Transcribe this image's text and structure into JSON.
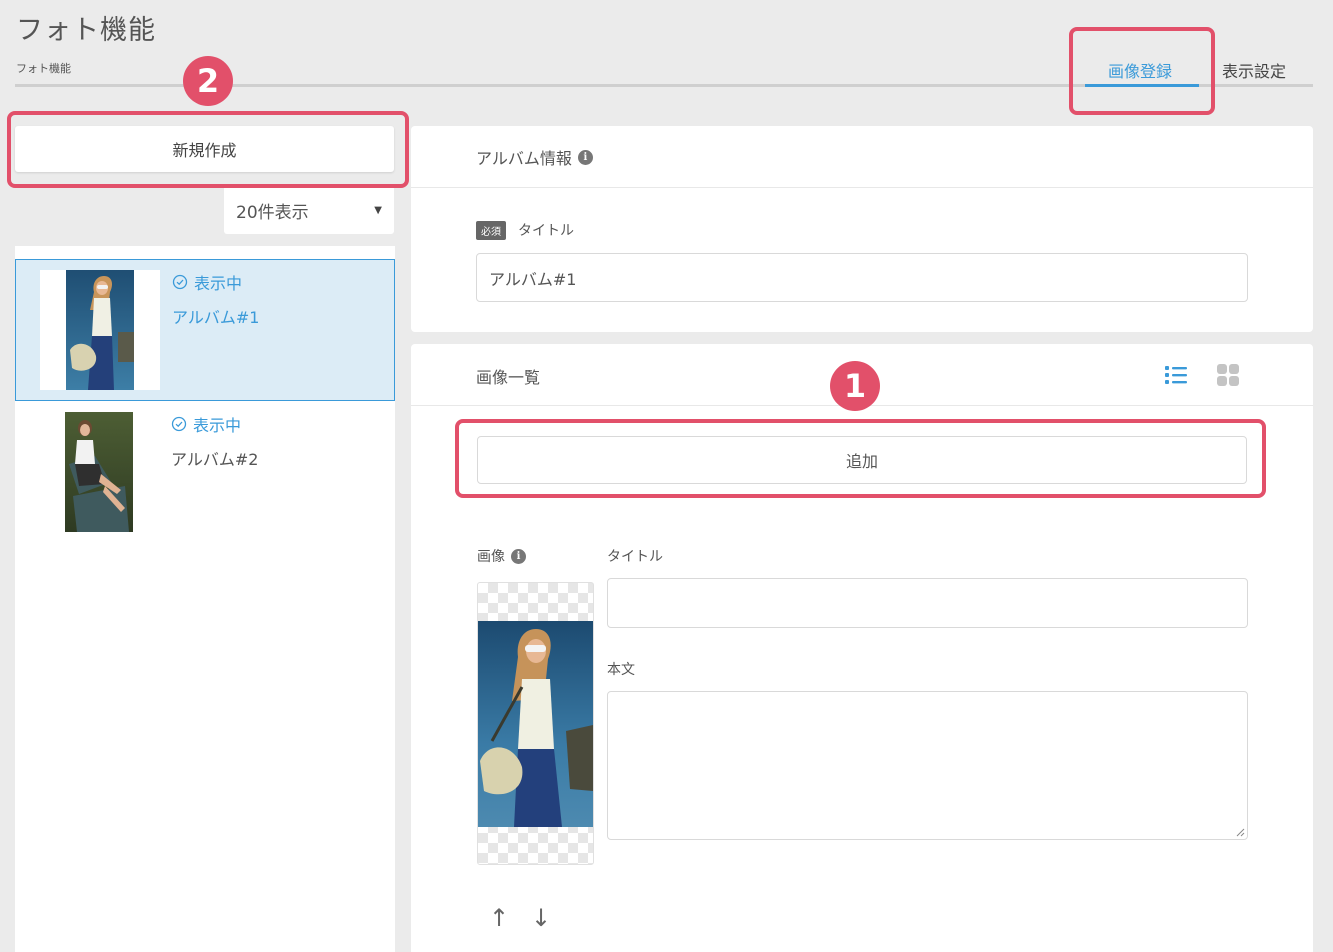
{
  "header": {
    "title": "フォト機能",
    "breadcrumb": "フォト機能",
    "tabs": [
      {
        "label": "画像登録",
        "active": true
      },
      {
        "label": "表示設定",
        "active": false
      }
    ]
  },
  "annotations": {
    "one": "1",
    "two": "2",
    "color": "#e2506a"
  },
  "sidebar": {
    "new_button": "新規作成",
    "count_select": {
      "selected": "20件表示"
    },
    "albums": [
      {
        "status": "表示中",
        "name": "アルバム#1",
        "selected": true
      },
      {
        "status": "表示中",
        "name": "アルバム#2",
        "selected": false
      }
    ]
  },
  "album_info": {
    "heading": "アルバム情報",
    "required_badge": "必須",
    "title_label": "タイトル",
    "title_value": "アルバム#1"
  },
  "image_list": {
    "heading": "画像一覧",
    "add_button": "追加",
    "image_label": "画像",
    "title_label": "タイトル",
    "title_value": "",
    "body_label": "本文",
    "body_value": "",
    "view_icons": [
      "list-view-icon",
      "grid-view-icon"
    ],
    "move_icons": [
      "arrow-up-icon",
      "arrow-down-icon"
    ]
  },
  "colors": {
    "accent": "#3a9ad9",
    "annotation": "#e2506a",
    "selected_bg": "#dcecf6"
  }
}
